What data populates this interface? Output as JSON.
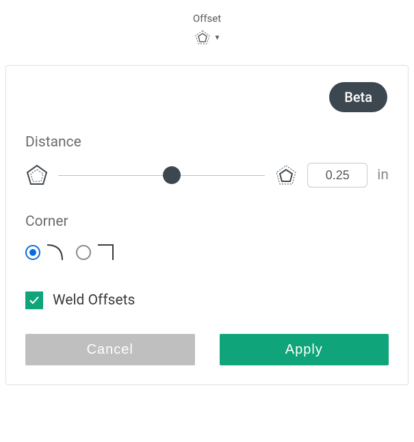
{
  "header": {
    "title": "Offset"
  },
  "panel": {
    "beta_label": "Beta",
    "distance": {
      "label": "Distance",
      "value": "0.25",
      "unit": "in"
    },
    "corner": {
      "label": "Corner",
      "selected": "round"
    },
    "weld": {
      "label": "Weld Offsets",
      "checked": true
    },
    "buttons": {
      "cancel": "Cancel",
      "apply": "Apply"
    }
  },
  "colors": {
    "accent": "#0fa47a",
    "radio_active": "#0a6ce0",
    "dark": "#3d4750"
  }
}
